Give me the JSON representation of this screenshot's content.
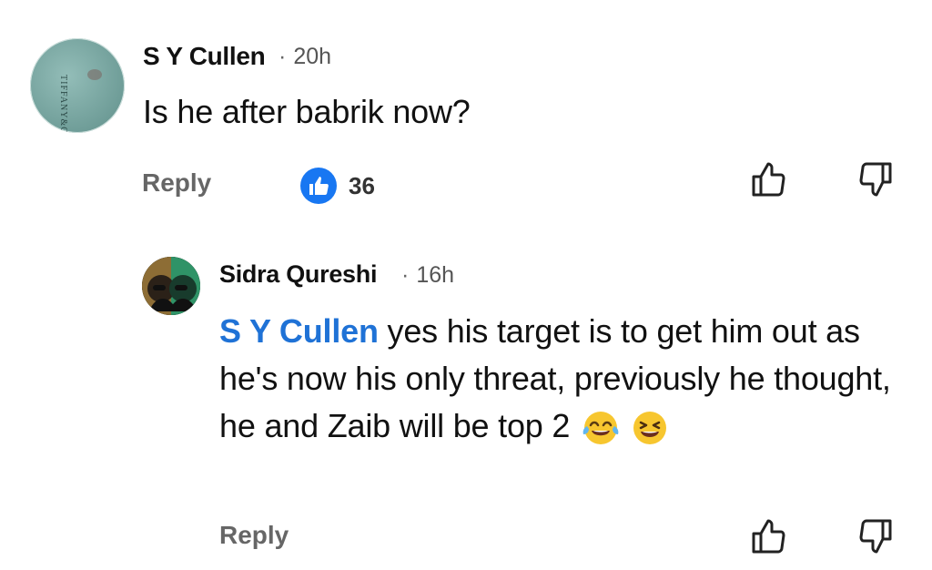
{
  "comment": {
    "author": "S Y Cullen",
    "time": "20h",
    "text": "Is he after babrik now?",
    "reply_label": "Reply",
    "like_count": "36",
    "avatar_brand": "TIFFANY&CO.",
    "icons": {
      "like_badge": "like-badge-icon",
      "thumb_up": "thumb-up-icon",
      "thumb_down": "thumb-down-icon"
    }
  },
  "reply": {
    "author": "Sidra Qureshi",
    "time": "16h",
    "mention": "S Y Cullen",
    "text": "yes his target is to get him out as he's now his only threat, previously he thought, he and Zaib will be top 2",
    "reply_label": "Reply",
    "emojis": [
      "face-with-tears-of-joy",
      "grinning-squinting-face"
    ]
  },
  "colors": {
    "accent_blue": "#1877f2",
    "mention_blue": "#1f72d6",
    "text": "#111111",
    "secondary_text": "#666666"
  }
}
